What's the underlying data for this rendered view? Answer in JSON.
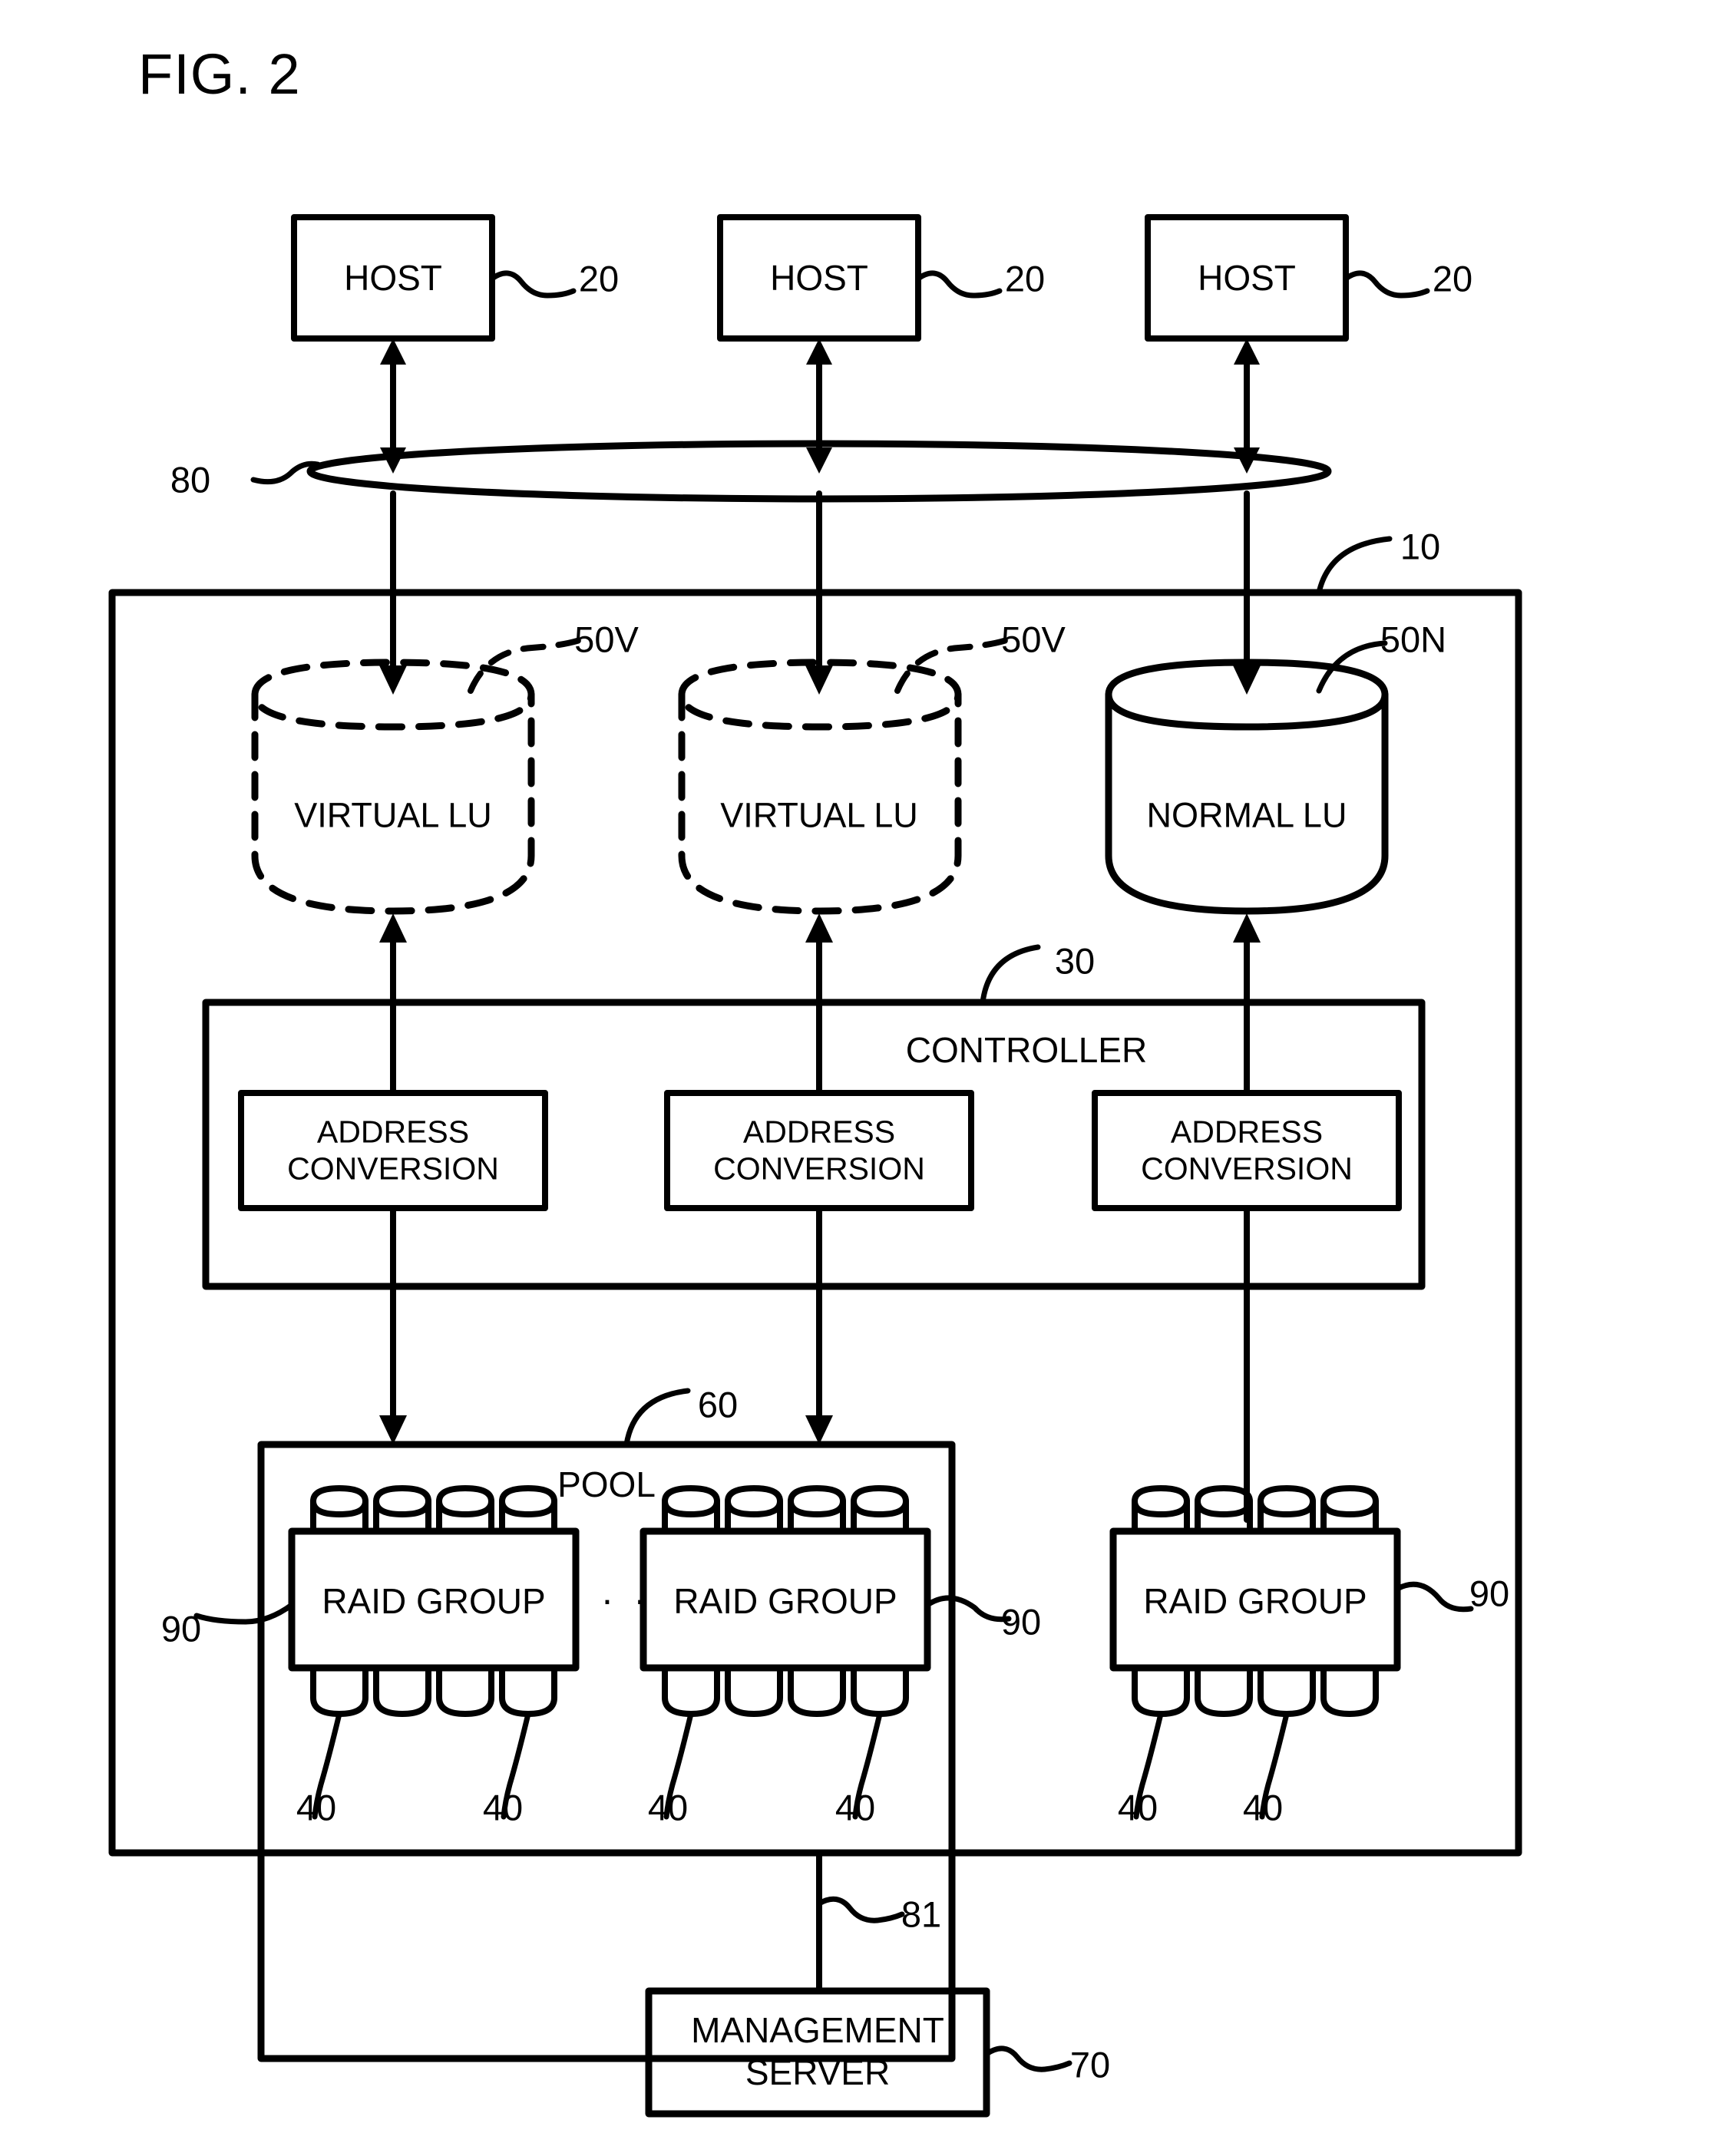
{
  "figure": {
    "title": "FIG. 2"
  },
  "hosts": [
    {
      "label": "HOST",
      "ref": "20"
    },
    {
      "label": "HOST",
      "ref": "20"
    },
    {
      "label": "HOST",
      "ref": "20"
    }
  ],
  "network": {
    "ref": "80"
  },
  "storage_system": {
    "ref": "10"
  },
  "logical_units": [
    {
      "label": "VIRTUAL LU",
      "ref": "50V",
      "type": "virtual"
    },
    {
      "label": "VIRTUAL LU",
      "ref": "50V",
      "type": "virtual"
    },
    {
      "label": "NORMAL LU",
      "ref": "50N",
      "type": "normal"
    }
  ],
  "controller": {
    "label": "CONTROLLER",
    "ref": "30",
    "modules": [
      {
        "line1": "ADDRESS",
        "line2": "CONVERSION"
      },
      {
        "line1": "ADDRESS",
        "line2": "CONVERSION"
      },
      {
        "line1": "ADDRESS",
        "line2": "CONVERSION"
      }
    ]
  },
  "pool": {
    "label": "POOL",
    "ref": "60",
    "ellipsis": "· · ·",
    "raid_groups": [
      {
        "label": "RAID GROUP",
        "ref": "90"
      },
      {
        "label": "RAID GROUP",
        "ref": "90"
      }
    ]
  },
  "external_raid_group": {
    "label": "RAID GROUP",
    "ref": "90"
  },
  "disk_refs": [
    "40",
    "40",
    "40",
    "40",
    "40",
    "40"
  ],
  "management": {
    "label_line1": "MANAGEMENT",
    "label_line2": "SERVER",
    "ref": "70",
    "link_ref": "81"
  },
  "colors": {
    "stroke": "#000000",
    "background": "#ffffff"
  }
}
